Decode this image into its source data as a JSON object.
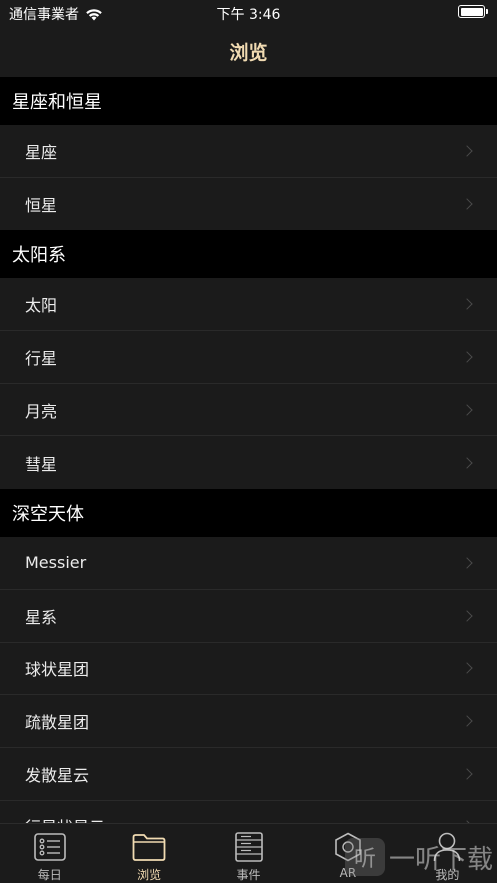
{
  "status_bar": {
    "carrier": "通信事業者",
    "time": "下午 3:46"
  },
  "nav": {
    "title": "浏览"
  },
  "sections": [
    {
      "header": "星座和恒星",
      "items": [
        "星座",
        "恒星"
      ]
    },
    {
      "header": "太阳系",
      "items": [
        "太阳",
        "行星",
        "月亮",
        "彗星"
      ]
    },
    {
      "header": "深空天体",
      "items": [
        "Messier",
        "星系",
        "球状星团",
        "疏散星团",
        "发散星云",
        "行星状星云"
      ]
    }
  ],
  "tabs": [
    {
      "label": "每日",
      "icon": "daily-icon"
    },
    {
      "label": "浏览",
      "icon": "folder-icon",
      "active": true
    },
    {
      "label": "事件",
      "icon": "events-icon"
    },
    {
      "label": "AR",
      "icon": "ar-icon"
    },
    {
      "label": "我的",
      "icon": "profile-icon"
    }
  ],
  "watermark": {
    "text": "一听下载",
    "badge": "听"
  },
  "colors": {
    "accent": "#f1dbb2",
    "background": "#000000",
    "cell": "#1b1b1b"
  }
}
